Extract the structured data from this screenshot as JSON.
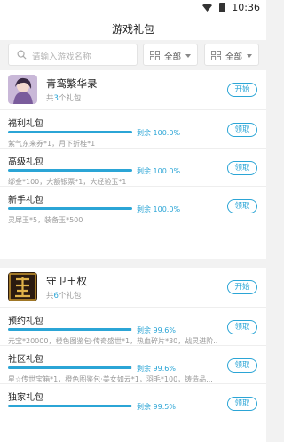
{
  "status": {
    "time": "10:36"
  },
  "header": {
    "title": "游戏礼包"
  },
  "filters": {
    "search_placeholder": "请输入游戏名称",
    "select1": "全部",
    "select2": "全部"
  },
  "games": [
    {
      "name": "青鸾繁华录",
      "count_prefix": "共",
      "count_num": "3",
      "count_suffix": "个礼包",
      "open_label": "开始",
      "gifts": [
        {
          "name": "福利礼包",
          "remaining_text": "剩余 100.0%",
          "remaining_pct": 100,
          "desc": "紫气东来券*1，月下折桂*1",
          "action": "领取"
        },
        {
          "name": "高级礼包",
          "remaining_text": "剩余 100.0%",
          "remaining_pct": 100,
          "desc": "绑金*100，大额银票*1，大经验玉*1",
          "action": "领取"
        },
        {
          "name": "新手礼包",
          "remaining_text": "剩余 100.0%",
          "remaining_pct": 100,
          "desc": "灵犀玉*5，装备玉*500",
          "action": "领取"
        }
      ]
    },
    {
      "name": "守卫王权",
      "count_prefix": "共",
      "count_num": "6",
      "count_suffix": "个礼包",
      "open_label": "开始",
      "gifts": [
        {
          "name": "预约礼包",
          "remaining_text": "剩余 99.6%",
          "remaining_pct": 99.6,
          "desc": "元宝*20000，橙色图鉴包·传奇盛世*1，热血碎片*30，战灵进阶...",
          "action": "领取"
        },
        {
          "name": "社区礼包",
          "remaining_text": "剩余 99.6%",
          "remaining_pct": 99.6,
          "desc": "星☆传世宝箱*1，橙色图鉴包·美女如云*1，羽毛*100，铸造品...",
          "action": "领取"
        },
        {
          "name": "独家礼包",
          "remaining_text": "剩余 99.5%",
          "remaining_pct": 99.5,
          "desc": "",
          "action": "领取"
        }
      ]
    }
  ],
  "colors": {
    "accent": "#2ba5d6",
    "background": "#f2f2f2"
  }
}
